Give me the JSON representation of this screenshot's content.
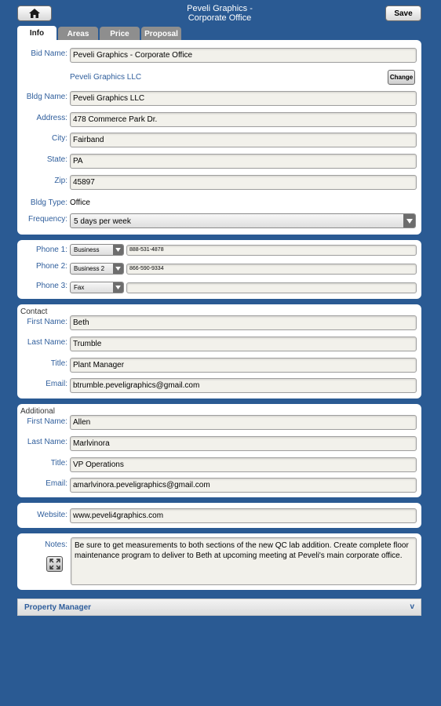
{
  "header": {
    "title_line1": "Peveli Graphics -",
    "title_line2": "Corporate Office",
    "save_label": "Save"
  },
  "tabs": [
    {
      "label": "Info",
      "active": true
    },
    {
      "label": "Areas",
      "active": false
    },
    {
      "label": "Price",
      "active": false
    },
    {
      "label": "Proposal",
      "active": false
    }
  ],
  "info": {
    "bid_name_label": "Bid Name:",
    "bid_name": "Peveli Graphics - Corporate Office",
    "company": "Peveli Graphics LLC",
    "change_label": "Change",
    "bldg_name_label": "Bldg Name:",
    "bldg_name": "Peveli Graphics LLC",
    "address_label": "Address:",
    "address": "478 Commerce Park Dr.",
    "city_label": "City:",
    "city": "Fairband",
    "state_label": "State:",
    "state": "PA",
    "zip_label": "Zip:",
    "zip": "45897",
    "bldg_type_label": "Bldg Type:",
    "bldg_type": "Office",
    "frequency_label": "Frequency:",
    "frequency": "5 days per week"
  },
  "phones": {
    "phone1_label": "Phone 1:",
    "phone1_type": "Business",
    "phone1_number": "888-531-4878",
    "phone2_label": "Phone 2:",
    "phone2_type": "Business 2",
    "phone2_number": "866-590-9334",
    "phone3_label": "Phone 3:",
    "phone3_type": "Fax",
    "phone3_number": ""
  },
  "contact": {
    "section_label": "Contact",
    "first_name_label": "First Name:",
    "first_name": "Beth",
    "last_name_label": "Last Name:",
    "last_name": "Trumble",
    "title_label": "Title:",
    "title": "Plant Manager",
    "email_label": "Email:",
    "email": "btrumble.peveligraphics@gmail.com"
  },
  "additional": {
    "section_label": "Additional",
    "first_name_label": "First Name:",
    "first_name": "Allen",
    "last_name_label": "Last Name:",
    "last_name": "Marlvinora",
    "title_label": "Title:",
    "title": "VP Operations",
    "email_label": "Email:",
    "email": "amarlvinora.peveligraphics@gmail.com"
  },
  "website": {
    "label": "Website:",
    "value": "www.peveli4graphics.com"
  },
  "notes": {
    "label": "Notes:",
    "value": "Be sure to get measurements to both sections of the new QC lab addition. Create complete floor maintenance program to deliver to Beth at upcoming meeting at Peveli's main corporate office."
  },
  "property_manager": {
    "label": "Property Manager",
    "chevron": "v"
  },
  "icons": {
    "home": "home-icon",
    "dropdown": "triangle-down-icon",
    "expand": "expand-arrows-icon"
  },
  "colors": {
    "background": "#2a5a93",
    "label_blue": "#2f5e9c",
    "field_bg": "#f2f1eb",
    "tab_inactive": "#8e8e8e"
  }
}
